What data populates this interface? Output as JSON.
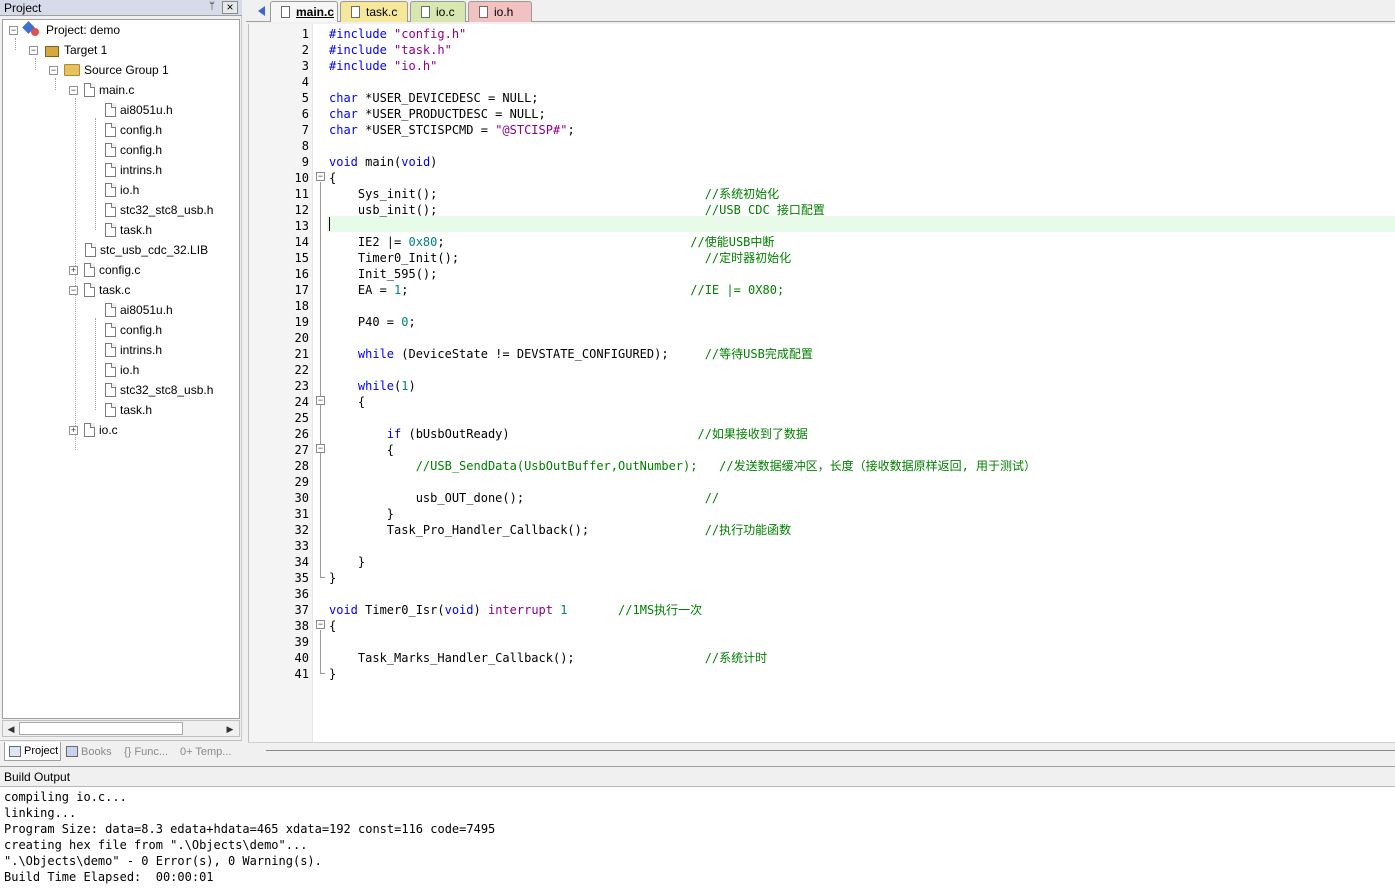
{
  "project_panel": {
    "title": "Project",
    "pin_glyph": "📌",
    "close_glyph": "×",
    "tree": {
      "project": "Project: demo",
      "target": "Target 1",
      "group": "Source Group 1",
      "main_c": "main.c",
      "main_children": [
        "ai8051u.h",
        "config.h",
        "config.h",
        "intrins.h",
        "io.h",
        "stc32_stc8_usb.h",
        "task.h"
      ],
      "lib": "stc_usb_cdc_32.LIB",
      "config_c": "config.c",
      "task_c": "task.c",
      "task_children": [
        "ai8051u.h",
        "config.h",
        "intrins.h",
        "io.h",
        "stc32_stc8_usb.h",
        "task.h"
      ],
      "io_c": "io.c"
    },
    "tabs": [
      "Project",
      "Books",
      "{} Func...",
      "0+ Temp..."
    ]
  },
  "editor": {
    "tabs": [
      {
        "label": "main.c",
        "color": "#f6f6f6",
        "active": true
      },
      {
        "label": "task.c",
        "color": "#f6e89a",
        "active": false
      },
      {
        "label": "io.c",
        "color": "#d8e6b0",
        "active": false
      },
      {
        "label": "io.h",
        "color": "#f2c1c1",
        "active": false
      }
    ],
    "line_numbers": [
      "1",
      "2",
      "3",
      "4",
      "5",
      "6",
      "7",
      "8",
      "9",
      "10",
      "11",
      "12",
      "13",
      "14",
      "15",
      "16",
      "17",
      "18",
      "19",
      "20",
      "21",
      "22",
      "23",
      "24",
      "25",
      "26",
      "27",
      "28",
      "29",
      "30",
      "31",
      "32",
      "33",
      "34",
      "35",
      "36",
      "37",
      "38",
      "39",
      "40",
      "41"
    ],
    "current_line": 13
  },
  "code": {
    "l1a": "#include ",
    "l1b": "\"config.h\"",
    "l2a": "#include ",
    "l2b": "\"task.h\"",
    "l3a": "#include ",
    "l3b": "\"io.h\"",
    "l5a": "char",
    "l5b": " *USER_DEVICEDESC = NULL;",
    "l6a": "char",
    "l6b": " *USER_PRODUCTDESC = NULL;",
    "l7a": "char",
    "l7b": " *USER_STCISPCMD = ",
    "l7c": "\"@STCISP#\"",
    "l7d": ";",
    "l9a": "void",
    "l9b": " main(",
    "l9c": "void",
    "l9d": ")",
    "l10": "{",
    "l11a": "    Sys_init();                                     ",
    "l11b": "//系统初始化",
    "l12a": "    usb_init();                                     ",
    "l12b": "//USB CDC 接口配置",
    "l14a": "    IE2 |= ",
    "l14b": "0x80",
    "l14c": ";                                  ",
    "l14d": "//使能USB中断",
    "l15a": "    Timer0_Init();                                  ",
    "l15b": "//定时器初始化",
    "l16": "    Init_595();",
    "l17a": "    EA = ",
    "l17b": "1",
    "l17c": ";                                       ",
    "l17d": "//IE |= 0X80;",
    "l19a": "    P40 = ",
    "l19b": "0",
    "l19c": ";",
    "l21a": "    ",
    "l21b": "while",
    "l21c": " (DeviceState != DEVSTATE_CONFIGURED);     ",
    "l21d": "//等待USB完成配置",
    "l23a": "    ",
    "l23b": "while",
    "l23c": "(",
    "l23d": "1",
    "l23e": ")",
    "l24": "    {",
    "l26a": "        ",
    "l26b": "if",
    "l26c": " (bUsbOutReady)                          ",
    "l26d": "//如果接收到了数据",
    "l27": "        {",
    "l28a": "            ",
    "l28b": "//USB_SendData(UsbOutBuffer,OutNumber);   //发送数据缓冲区，长度（接收数据原样返回, 用于测试）",
    "l30a": "            usb_OUT_done();                         ",
    "l30b": "//",
    "l31": "        }",
    "l32a": "        Task_Pro_Handler_Callback();                ",
    "l32b": "//执行功能函数",
    "l34": "    }",
    "l35": "}",
    "l37a": "void",
    "l37b": " Timer0_Isr(",
    "l37c": "void",
    "l37d": ") ",
    "l37e": "interrupt",
    "l37f": " ",
    "l37g": "1",
    "l37h": "       ",
    "l37i": "//1MS执行一次",
    "l38": "{",
    "l40a": "    Task_Marks_Handler_Callback();                  ",
    "l40b": "//系统计时",
    "l41": "}"
  },
  "build_output": {
    "title": "Build Output",
    "lines": [
      "compiling io.c...",
      "linking...",
      "Program Size: data=8.3 edata+hdata=465 xdata=192 const=116 code=7495",
      "creating hex file from \".\\Objects\\demo\"...",
      "\".\\Objects\\demo\" - 0 Error(s), 0 Warning(s).",
      "Build Time Elapsed:  00:00:01"
    ]
  }
}
